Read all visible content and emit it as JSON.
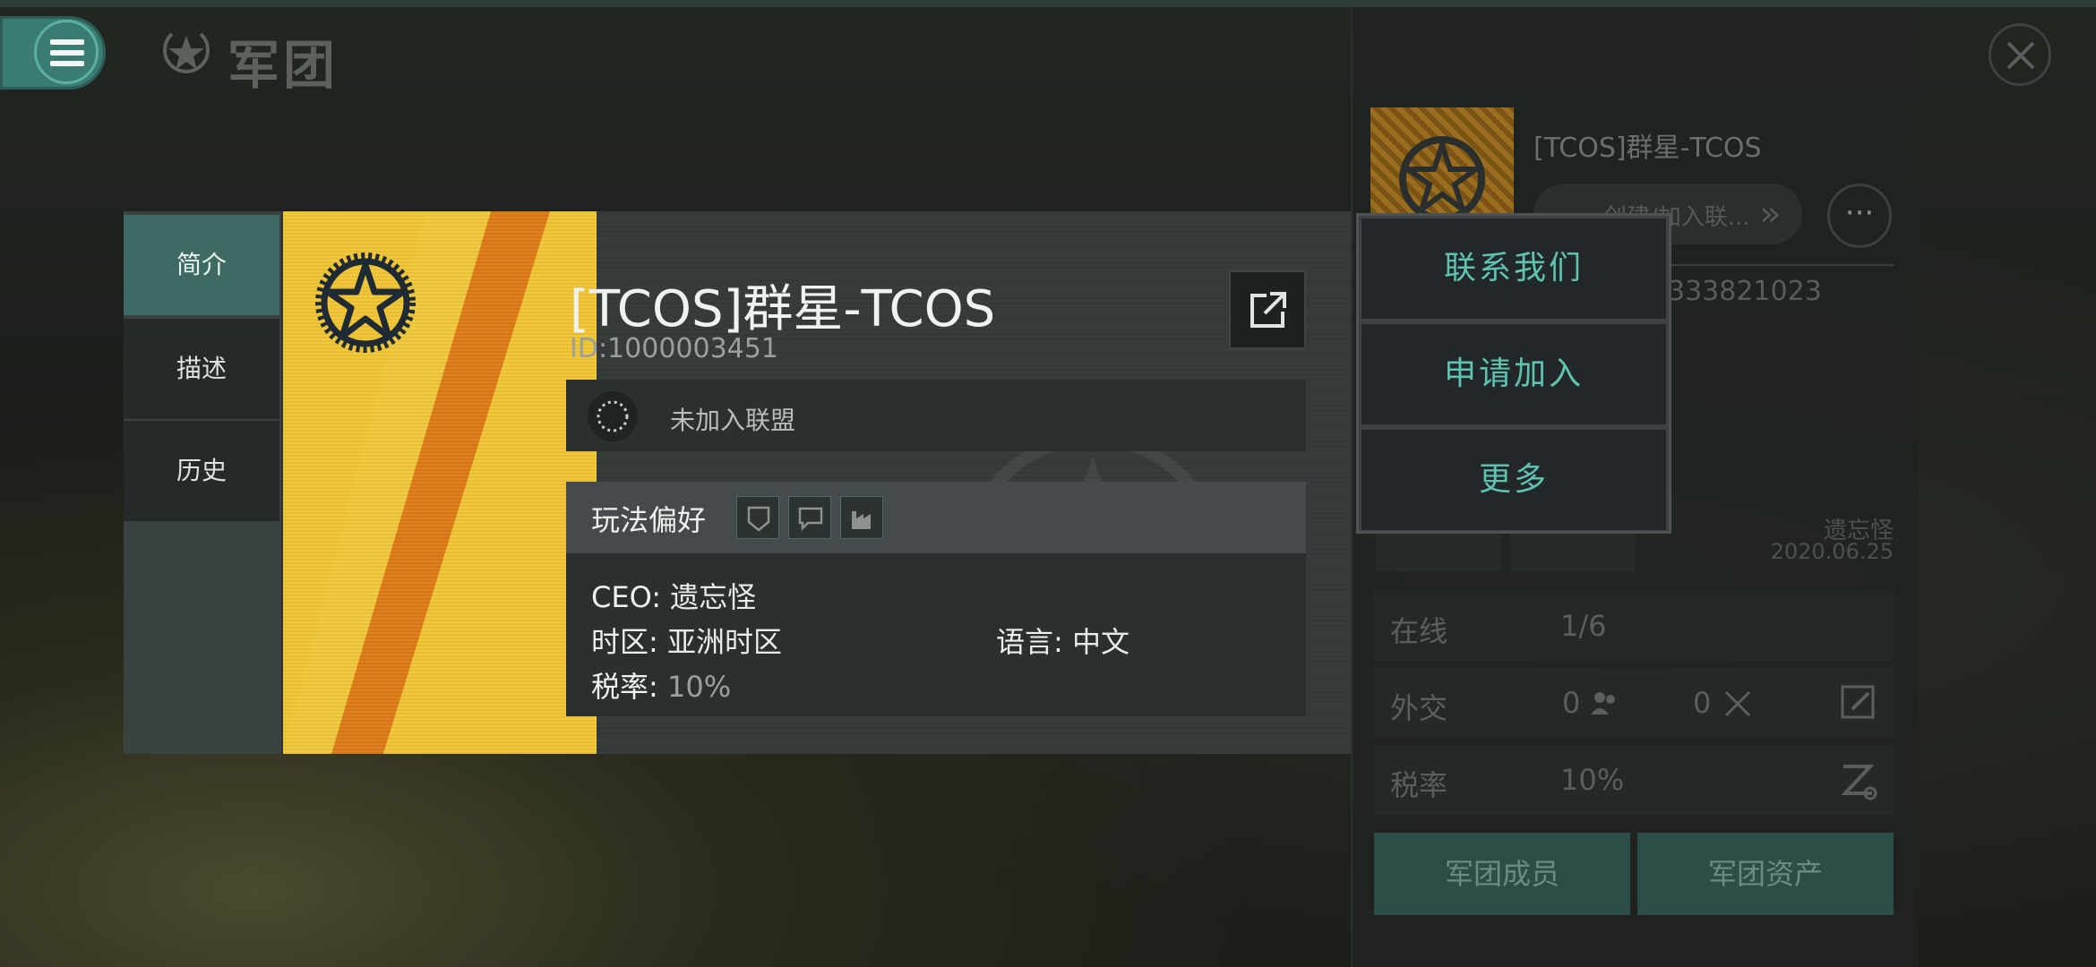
{
  "header": {
    "title": "军团",
    "title_icon": "star-badge-icon",
    "menu_icon": "hamburger-menu-icon",
    "close_icon": "close-icon"
  },
  "tabs": [
    {
      "label": "简介",
      "active": true
    },
    {
      "label": "描述",
      "active": false
    },
    {
      "label": "历史",
      "active": false
    }
  ],
  "corp": {
    "name": "[TCOS]群星-TCOS",
    "id_text": "ID:1000003451",
    "alliance_status": "未加入联盟",
    "pref_label": "玩法偏好",
    "ceo_label": "CEO:",
    "ceo_value": "遗忘怪",
    "tz_label": "时区:",
    "tz_value": "亚洲时区",
    "lang_label": "语言:",
    "lang_value": "中文",
    "tax_label": "税率:",
    "tax_value": "10%"
  },
  "popup": {
    "items": [
      "联系我们",
      "申请加入",
      "更多"
    ]
  },
  "right_panel": {
    "name": "[TCOS]群星-TCOS",
    "pill_text": "创建/加入联...",
    "id_partial": "333821023",
    "ceo": "遗忘怪",
    "date": "2020.06.25",
    "online_label": "在线",
    "online_value": "1/6",
    "diplomacy_label": "外交",
    "diplomacy_friends": "0",
    "diplomacy_enemies": "0",
    "tax_label": "税率",
    "tax_value": "10%",
    "members_button": "军团成员",
    "assets_button": "军团资产"
  },
  "colors": {
    "accent": "#5fc3b0",
    "banner_yellow": "#f3c93a",
    "banner_orange": "#e07f1c",
    "tab_active": "#3d6b64"
  }
}
